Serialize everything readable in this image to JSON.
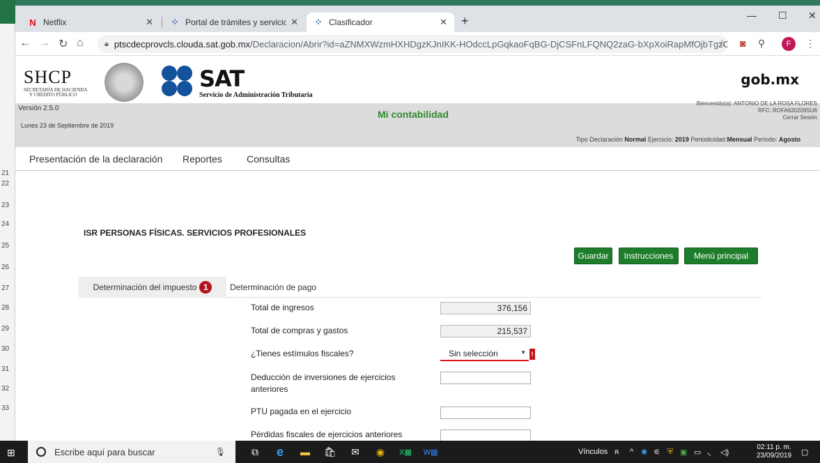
{
  "excel_rows": [
    "21",
    "22",
    "23",
    "24",
    "25",
    "26",
    "27",
    "28",
    "29",
    "30",
    "31",
    "32",
    "33"
  ],
  "tabs": [
    {
      "title": "Netflix",
      "icon": "netflix-icon"
    },
    {
      "title": "Portal de trámites y servicios - SA",
      "icon": "sat-icon"
    },
    {
      "title": "Clasificador",
      "icon": "sat-icon"
    }
  ],
  "address": {
    "host": "ptscdecprovcls.clouda.sat.gob.mx",
    "path": "/Declaracion/Abrir?id=aZNMXWzmHXHDgzKJnIKK-HOdccLpGqkaoFqBG-DjCSFnLFQNQ2zaG-bXpXoiRapMfOjbTgzC8AJyNo...",
    "profile_initial": "F"
  },
  "header": {
    "shcp": "SHCP",
    "shcp_sub1": "SECRETARÍA DE HACIENDA",
    "shcp_sub2": "Y CRÉDITO PÚBLICO",
    "sat": "SAT",
    "sat_sub": "Servicio de Administración Tributaria",
    "gobmx": "gob.mx"
  },
  "band": {
    "version": "Versión 2.5.0",
    "date": "Lunes 23 de Septiembre de 2019",
    "title": "Mi contabilidad",
    "welcome": "Bienvenido(a): ANTONIO DE LA ROSA FLORES",
    "rfc": "RFC: ROFA630209SU6",
    "logout": "Cerrar Sesión",
    "period_prefix": "Tipo Declaración ",
    "tipo": "Normal",
    "ejercicio_label": " Ejercicio: ",
    "ejercicio": "2019",
    "periodicidad_label": " Periodicidad:",
    "periodicidad": "Mensual",
    "periodo_label": " Periodo: ",
    "periodo": "Agosto"
  },
  "menu": [
    "Presentación de la declaración",
    "Reportes",
    "Consultas"
  ],
  "content": {
    "title": "ISR PERSONAS FÍSICAS. SERVICIOS PROFESIONALES",
    "buttons": {
      "save": "Guardar",
      "instructions": "Instrucciones",
      "main": "Menú principal"
    },
    "tab_active": "Determinación del impuesto",
    "tab_badge": "1",
    "tab_other": "Determinación de pago",
    "fields": {
      "ingresos_label": "Total de ingresos",
      "ingresos_value": "376,156",
      "compras_label": "Total de compras y gastos",
      "compras_value": "215,537",
      "estimulos_label": "¿Tienes estímulos fiscales?",
      "estimulos_value": "Sin selección",
      "deduccion_label_1": "Deducción de inversiones de ejercicios",
      "deduccion_label_2": "anteriores",
      "ptu_label": "PTU pagada en el ejercicio",
      "perdidas_label": "Pérdidas fiscales de ejercicios anteriores"
    }
  },
  "taskbar": {
    "search_placeholder": "Escribe aquí para buscar",
    "vinculos": "Vínculos",
    "time": "02:11 p. m.",
    "date": "23/09/2019"
  },
  "colors": {
    "accent_green": "#1e7d2a",
    "title_green": "#2e8b2e",
    "error_red": "#c4151c",
    "sat_blue": "#13539c"
  }
}
